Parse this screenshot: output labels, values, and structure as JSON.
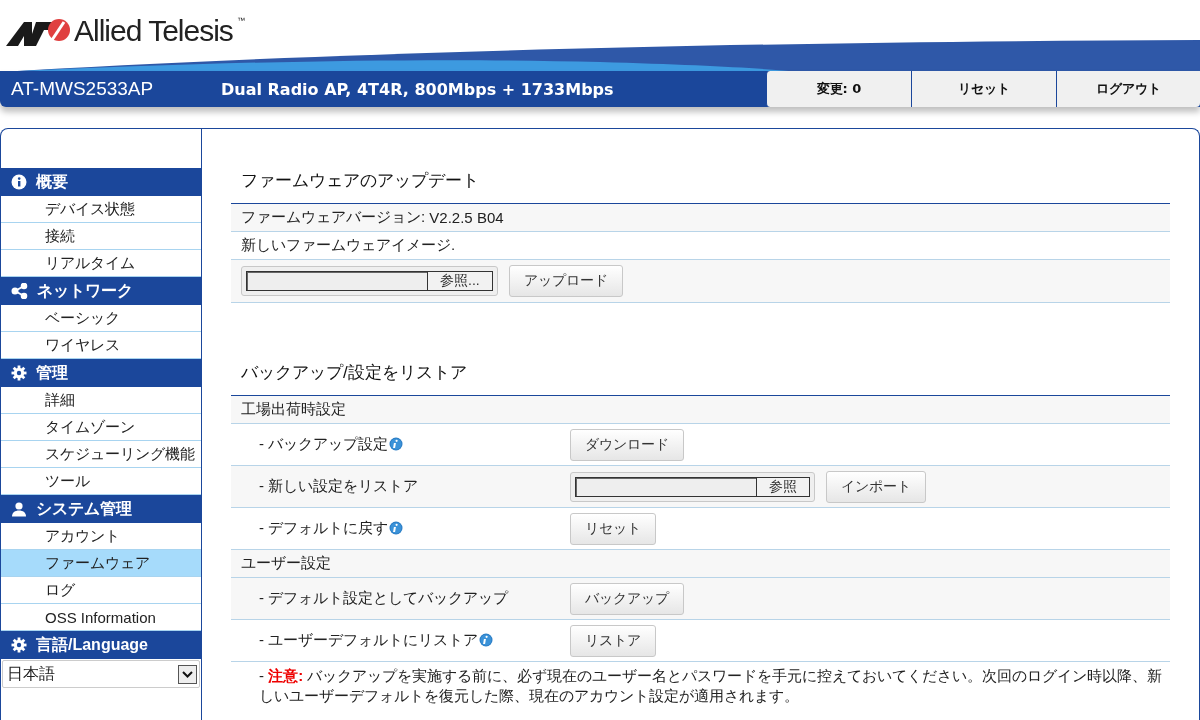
{
  "logo": {
    "name": "Allied Telesis",
    "mark": "™"
  },
  "header": {
    "model": "AT-MWS2533AP",
    "description": "Dual Radio AP, 4T4R, 800Mbps + 1733Mbps",
    "buttons": [
      {
        "label": "変更: 0"
      },
      {
        "label": "リセット"
      },
      {
        "label": "ログアウト"
      }
    ]
  },
  "sidebar": {
    "sections": [
      {
        "title": "概要",
        "items": [
          {
            "label": "デバイス状態",
            "selected": false
          },
          {
            "label": "接続",
            "selected": false
          },
          {
            "label": "リアルタイム",
            "selected": false
          }
        ]
      },
      {
        "title": "ネットワーク",
        "items": [
          {
            "label": "ベーシック",
            "selected": false
          },
          {
            "label": "ワイヤレス",
            "selected": false
          }
        ]
      },
      {
        "title": "管理",
        "items": [
          {
            "label": "詳細",
            "selected": false
          },
          {
            "label": "タイムゾーン",
            "selected": false
          },
          {
            "label": "スケジューリング機能",
            "selected": false
          },
          {
            "label": "ツール",
            "selected": false
          }
        ]
      },
      {
        "title": "システム管理",
        "items": [
          {
            "label": "アカウント",
            "selected": false
          },
          {
            "label": "ファームウェア",
            "selected": true
          },
          {
            "label": "ログ",
            "selected": false
          },
          {
            "label": "OSS Information",
            "selected": false
          }
        ]
      },
      {
        "title": "言語/Language"
      }
    ],
    "language_select": {
      "value": "日本語"
    }
  },
  "firmware": {
    "title": "ファームウェアのアップデート",
    "version_label": "ファームウェアバージョン:",
    "version": "V2.2.5 B04",
    "image_label": "新しいファームウェアイメージ.",
    "browse_button": "参照...",
    "upload_button": "アップロード"
  },
  "backup": {
    "title": "バックアップ/設定をリストア",
    "rows": [
      {
        "kind": "group",
        "label": "工場出荷時設定"
      },
      {
        "kind": "action",
        "label": "- バックアップ設定",
        "info": true,
        "controls": [
          {
            "kind": "button",
            "label": "ダウンロード"
          }
        ]
      },
      {
        "kind": "action",
        "label": "- 新しい設定をリストア",
        "info": false,
        "controls": [
          {
            "kind": "file",
            "label": "参照"
          },
          {
            "kind": "button",
            "label": "インポート"
          }
        ]
      },
      {
        "kind": "action",
        "label": "- デフォルトに戻す",
        "info": true,
        "controls": [
          {
            "kind": "button",
            "label": "リセット"
          }
        ]
      },
      {
        "kind": "group",
        "label": "ユーザー設定"
      },
      {
        "kind": "action",
        "label": "- デフォルト設定としてバックアップ",
        "info": false,
        "controls": [
          {
            "kind": "button",
            "label": "バックアップ"
          }
        ]
      },
      {
        "kind": "action",
        "label": "- ユーザーデフォルトにリストア",
        "info": true,
        "controls": [
          {
            "kind": "button",
            "label": "リストア"
          }
        ]
      }
    ],
    "note": "- **注意:** バックアップを実施する前に、必ず現在のユーザー名とパスワードを手元に控えておいてください。次回のログイン時以降、新しいユーザーデフォルトを復元した際、現在のアカウント設定が適用されます。"
  }
}
